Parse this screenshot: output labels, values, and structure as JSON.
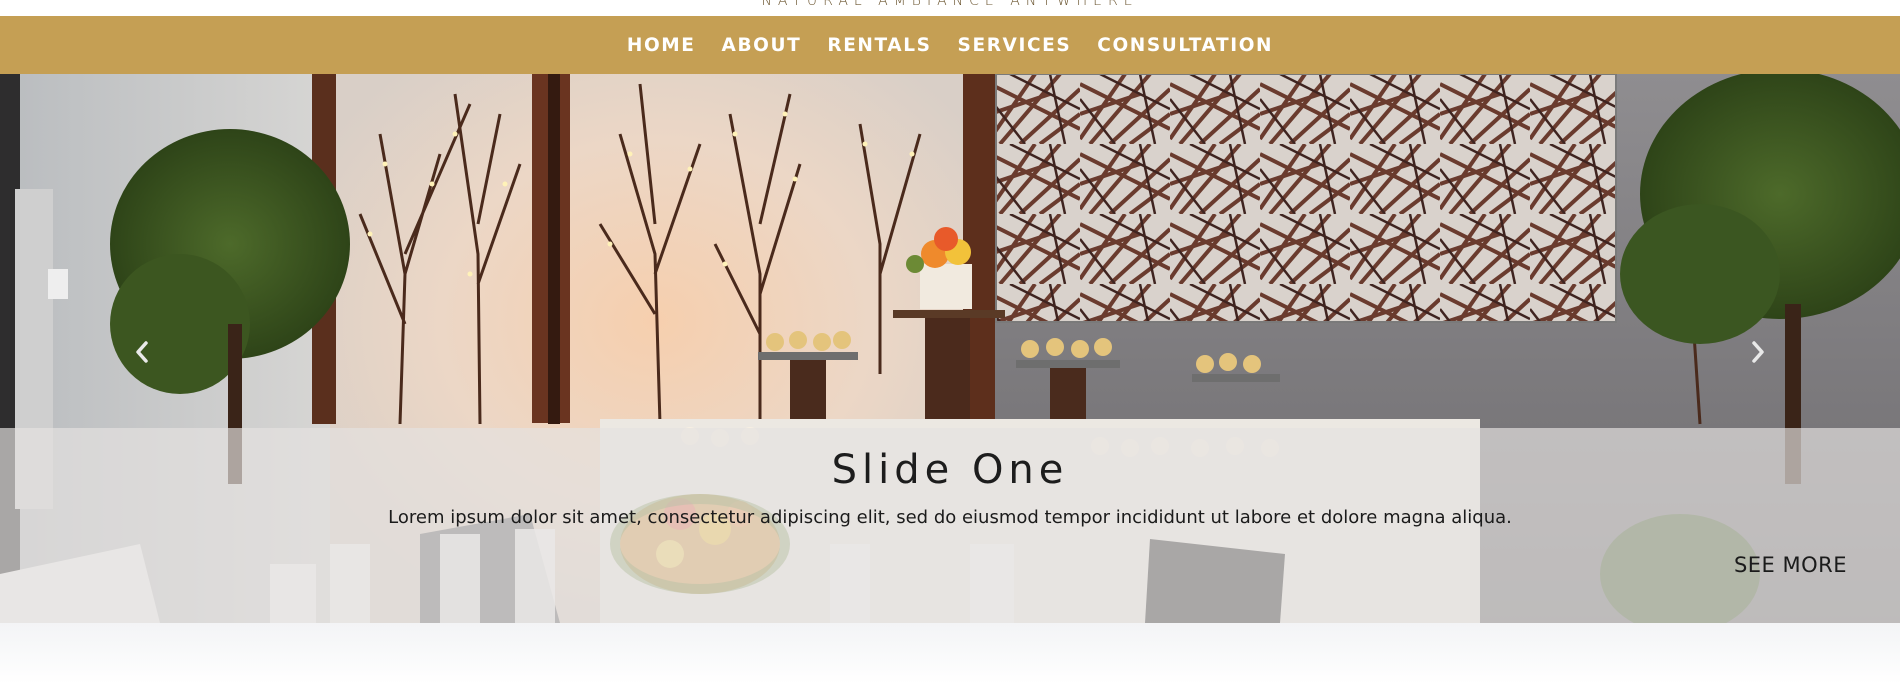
{
  "header": {
    "tagline": "NATURAL AMBIANCE ANYWHERE"
  },
  "nav": {
    "items": [
      {
        "label": "HOME"
      },
      {
        "label": "ABOUT"
      },
      {
        "label": "RENTALS"
      },
      {
        "label": "SERVICES"
      },
      {
        "label": "CONSULTATION"
      }
    ]
  },
  "hero": {
    "slide_title": "Slide One",
    "slide_text": "Lorem ipsum dolor sit amet, consectetur adipiscing elit, sed do eiusmod tempor incididunt ut labore et dolore magna aliqua.",
    "see_more_label": "SEE MORE",
    "prev_icon": "chevron-left-icon",
    "next_icon": "chevron-right-icon"
  },
  "colors": {
    "nav_background": "#c59f54",
    "nav_text": "#ffffff",
    "caption_overlay": "rgba(228,226,224,0.68)"
  }
}
